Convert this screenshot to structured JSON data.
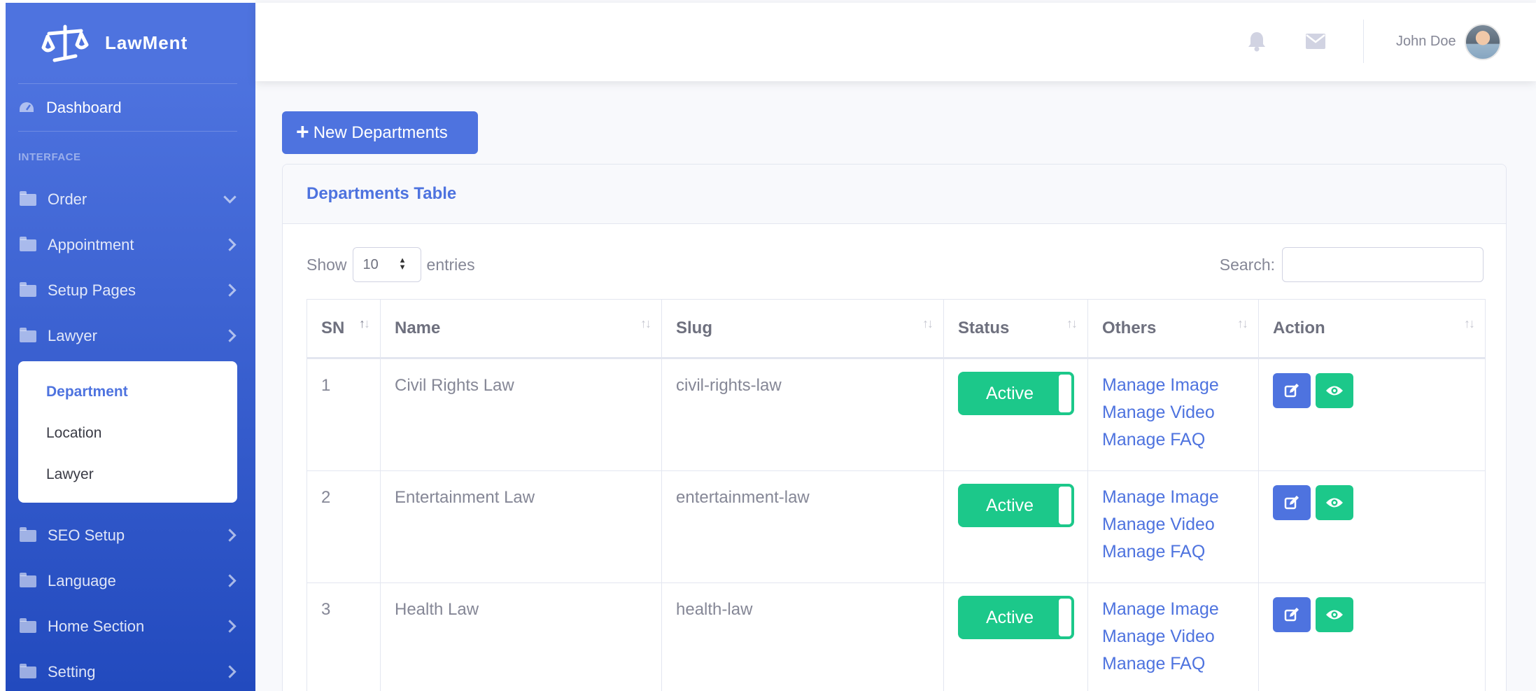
{
  "brand": {
    "name": "LawMent"
  },
  "sidebar": {
    "dashboard": "Dashboard",
    "heading": "INTERFACE",
    "items": [
      {
        "label": "Order",
        "chevron": "down"
      },
      {
        "label": "Appointment",
        "chevron": "right"
      },
      {
        "label": "Setup Pages",
        "chevron": "right"
      },
      {
        "label": "Lawyer",
        "chevron": "right"
      }
    ],
    "submenu": [
      "Department",
      "Location",
      "Lawyer"
    ],
    "items_after": [
      {
        "label": "SEO Setup"
      },
      {
        "label": "Language"
      },
      {
        "label": "Home Section"
      },
      {
        "label": "Setting"
      }
    ]
  },
  "topbar": {
    "user_name": "John Doe"
  },
  "main": {
    "new_button": "New Departments",
    "card_title": "Departments Table",
    "show_label": "Show",
    "entries_value": "10",
    "entries_label": "entries",
    "search_label": "Search:"
  },
  "table": {
    "columns": [
      "SN",
      "Name",
      "Slug",
      "Status",
      "Others",
      "Action"
    ],
    "rows": [
      {
        "sn": "1",
        "name": "Civil Rights Law",
        "slug": "civil-rights-law",
        "status": "Active"
      },
      {
        "sn": "2",
        "name": "Entertainment Law",
        "slug": "entertainment-law",
        "status": "Active"
      },
      {
        "sn": "3",
        "name": "Health Law",
        "slug": "health-law",
        "status": "Active"
      }
    ],
    "links": [
      "Manage Image",
      "Manage Video",
      "Manage FAQ"
    ]
  },
  "colors": {
    "primary": "#4e73df",
    "success": "#1cc88a",
    "text": "#858796"
  }
}
